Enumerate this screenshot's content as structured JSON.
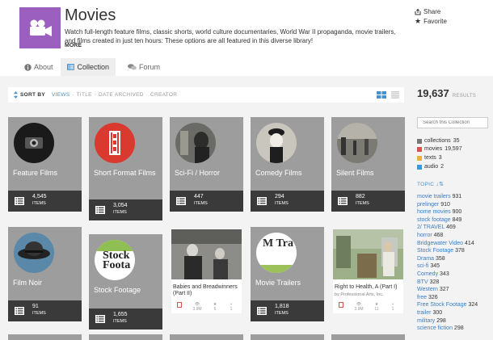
{
  "collection": {
    "title": "Movies",
    "description": "Watch full-length feature films, classic shorts, world culture documentaries, World War II propaganda, movie trailers, and films created in just ten hours: These options are all featured in this diverse library!",
    "more_label": "MORE",
    "logo_icon": "movie-camera-icon",
    "logo_color": "#9b5fc0"
  },
  "actions": {
    "share_label": "Share",
    "favorite_label": "Favorite"
  },
  "tabs": [
    {
      "label": "About",
      "icon": "info-icon"
    },
    {
      "label": "Collection",
      "icon": "collection-icon",
      "active": true
    },
    {
      "label": "Forum",
      "icon": "forum-icon"
    }
  ],
  "sort": {
    "label": "SORT BY",
    "options": [
      "VIEWS",
      "TITLE",
      "DATE ARCHIVED",
      "CREATOR"
    ],
    "active": "VIEWS"
  },
  "results": {
    "count": "19,637",
    "label": "RESULTS"
  },
  "search": {
    "placeholder": "Search this Collection"
  },
  "media_types": [
    {
      "label": "collections",
      "count": "35",
      "color": "#777777"
    },
    {
      "label": "movies",
      "count": "19,597",
      "color": "#d9534f"
    },
    {
      "label": "texts",
      "count": "3",
      "color": "#e8b33c"
    },
    {
      "label": "audio",
      "count": "2",
      "color": "#3a9ad9"
    }
  ],
  "topic": {
    "label": "TOPIC"
  },
  "topics": [
    {
      "name": "movie trailers",
      "count": "931"
    },
    {
      "name": "prelinger",
      "count": "910"
    },
    {
      "name": "home movies",
      "count": "900"
    },
    {
      "name": "stock footage",
      "count": "849"
    },
    {
      "name": "2/ TRAVEL",
      "count": "469"
    },
    {
      "name": "horror",
      "count": "468"
    },
    {
      "name": "Bridgewater Video",
      "count": "414"
    },
    {
      "name": "Stock Footage",
      "count": "378"
    },
    {
      "name": "Drama",
      "count": "358"
    },
    {
      "name": "sci-fi",
      "count": "345"
    },
    {
      "name": "Comedy",
      "count": "343"
    },
    {
      "name": "BTV",
      "count": "328"
    },
    {
      "name": "Western",
      "count": "327"
    },
    {
      "name": "free",
      "count": "326"
    },
    {
      "name": "Free Stock Footage",
      "count": "324"
    },
    {
      "name": "trailer",
      "count": "300"
    },
    {
      "name": "military",
      "count": "298"
    },
    {
      "name": "science fiction",
      "count": "298"
    }
  ],
  "tiles": [
    {
      "name": "Feature Films",
      "count": "4,545",
      "count_label": "ITEMS"
    },
    {
      "name": "Short Format Films",
      "count": "3,054",
      "count_label": "ITEMS"
    },
    {
      "name": "Sci-Fi / Horror",
      "count": "447",
      "count_label": "ITEMS"
    },
    {
      "name": "Comedy Films",
      "count": "294",
      "count_label": "ITEMS"
    },
    {
      "name": "Silent Films",
      "count": "882",
      "count_label": "ITEMS"
    },
    {
      "name": "Film Noir",
      "count": "91",
      "count_label": "ITEMS"
    },
    {
      "name": "Stock Footage",
      "count": "1,655",
      "count_label": "ITEMS",
      "thumb_text": "Stock Foota"
    },
    {
      "name": "Movie Trailers",
      "count": "1,818",
      "count_label": "ITEMS",
      "thumb_text": "M Tra"
    }
  ],
  "items": [
    {
      "title": "Babies and Breadwinners (Part II)",
      "by": "",
      "views": "3.9M",
      "favs": "6",
      "reviews": "1"
    },
    {
      "title": "Right to Health, A (Part I)",
      "by": "by Professional Arts, Inc.",
      "views": "3.9M",
      "favs": "11",
      "reviews": "1"
    }
  ]
}
